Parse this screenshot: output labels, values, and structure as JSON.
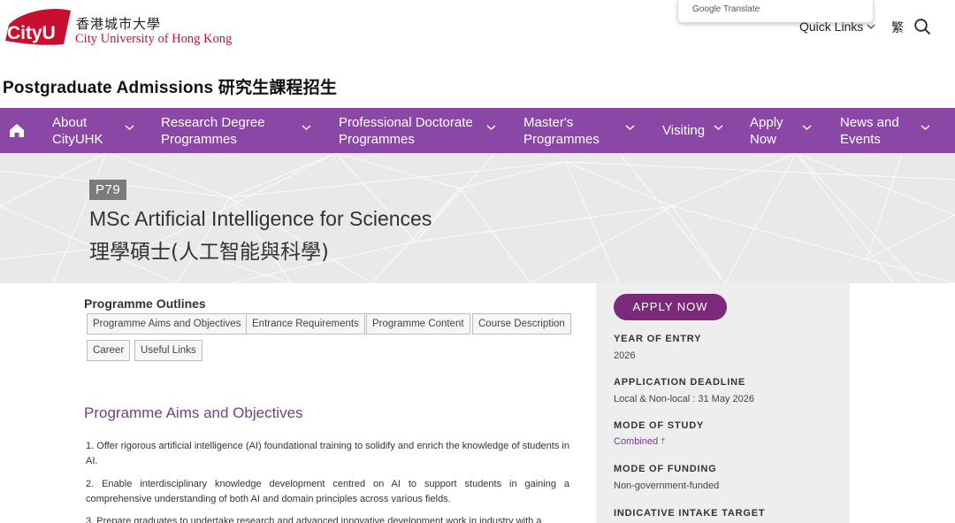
{
  "header": {
    "logo_mark_text": "CityU",
    "logo_cn": "香港城市大學",
    "logo_en": "City University of Hong Kong",
    "google_translate": "Google Translate",
    "quick_links": "Quick Links",
    "lang_toggle": "繁",
    "site_title": "Postgraduate Admissions 研究生課程招生"
  },
  "nav": {
    "items": [
      {
        "label": "About\nCityUHK"
      },
      {
        "label": "Research Degree\nProgrammes"
      },
      {
        "label": "Professional Doctorate\nProgrammes"
      },
      {
        "label": "Master's\nProgrammes"
      },
      {
        "label": "Visiting"
      },
      {
        "label": "Apply\nNow"
      },
      {
        "label": "News and\nEvents"
      }
    ]
  },
  "hero": {
    "code": "P79",
    "title_en": "MSc Artificial Intelligence for Sciences",
    "title_cn": "理學碩士(人工智能與科學)"
  },
  "main": {
    "outlines_title": "Programme Outlines",
    "tags": [
      "Programme Aims and Objectives",
      "Entrance Requirements",
      "Programme Content",
      "Course Description",
      "Career",
      "Useful Links"
    ],
    "section_title": "Programme Aims and Objectives",
    "paragraphs": [
      "1. Offer rigorous artificial intelligence (AI) foundational training to solidify and enrich the knowledge of students in AI.",
      "2. Enable interdisciplinary knowledge development centred on AI to support students in gaining a comprehensive understanding of both AI and domain principles across various fields.",
      "3. Prepare graduates to undertake research and advanced innovative development work in industry with a"
    ]
  },
  "sidebar": {
    "apply_label": "APPLY NOW",
    "year_label": "YEAR OF ENTRY",
    "year_value": "2026",
    "deadline_label": "APPLICATION DEADLINE",
    "deadline_value": "Local & Non-local : 31 May 2026",
    "study_label": "MODE OF STUDY",
    "study_value": "Combined",
    "study_mark": "†",
    "funding_label": "MODE OF FUNDING",
    "funding_value": "Non-government-funded",
    "intake_label": "INDICATIVE INTAKE TARGET"
  },
  "colors": {
    "nav_bg": "#8a47a6",
    "brand_red": "#c8102e",
    "apply_btn": "#7a2a78",
    "section_title": "#7b3a8e"
  },
  "icons": [
    "home-icon",
    "chevron-down-icon",
    "search-icon"
  ]
}
